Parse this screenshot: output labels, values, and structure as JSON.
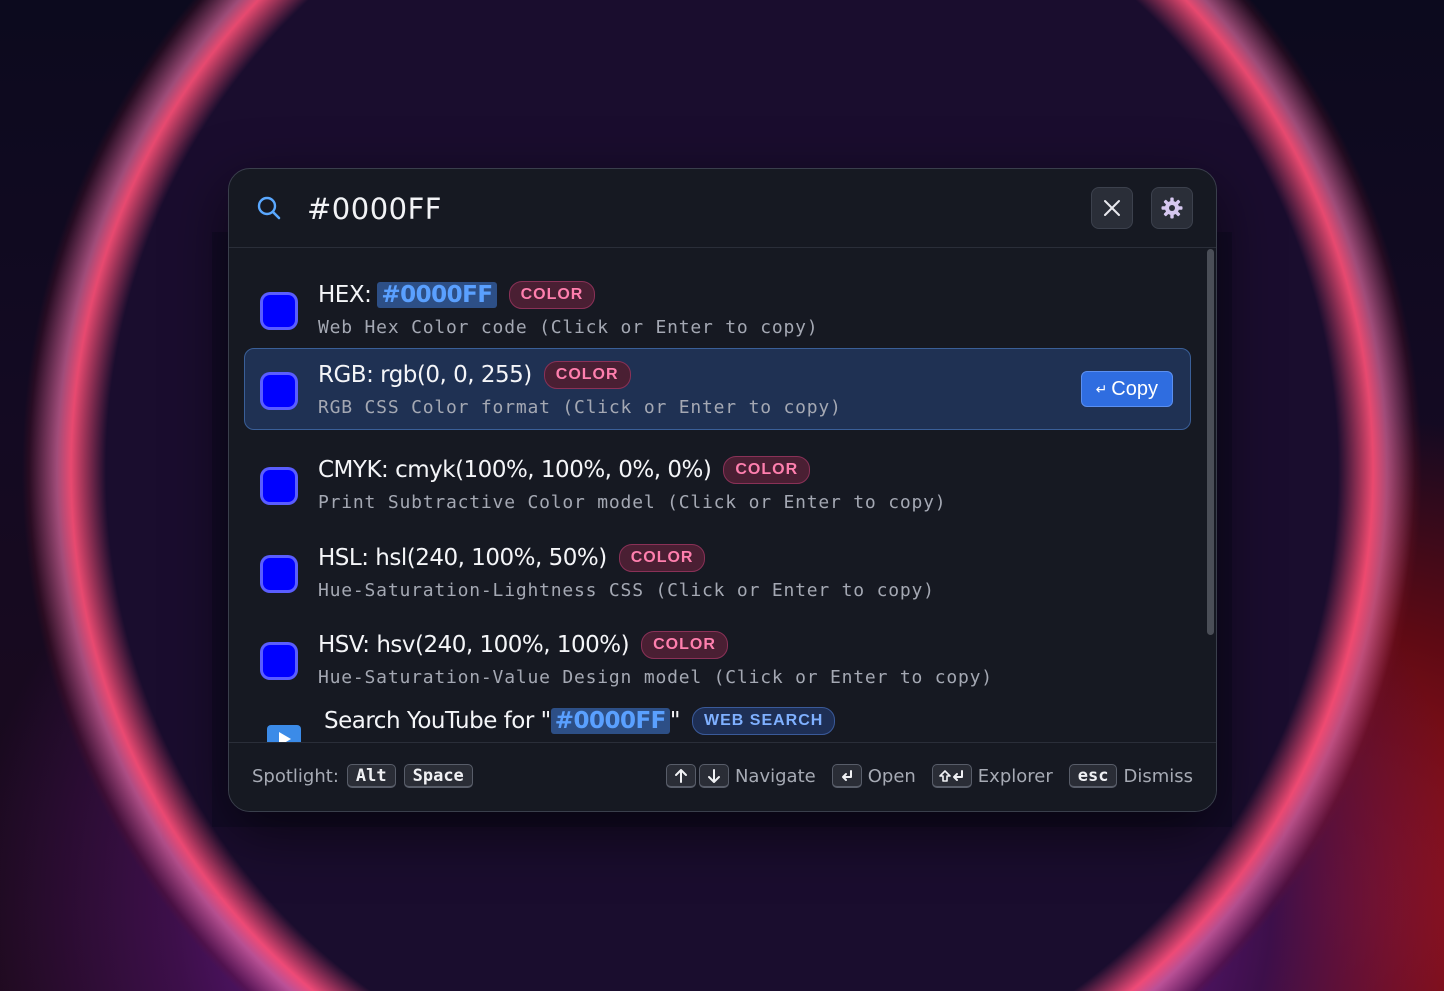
{
  "search": {
    "value": "#0000FF",
    "query": "#0000FF"
  },
  "results": [
    {
      "prefix": "HEX:",
      "highlight": "#0000FF",
      "badge": "COLOR",
      "subtitle": "Web Hex Color code (Click or Enter to copy)",
      "swatch": "#0000FF"
    },
    {
      "prefix": "RGB: rgb(0, 0, 255)",
      "badge": "COLOR",
      "subtitle": "RGB CSS Color format (Click or Enter to copy)",
      "swatch": "#0000FF",
      "selected": true
    },
    {
      "prefix": "CMYK: cmyk(100%, 100%, 0%, 0%)",
      "badge": "COLOR",
      "subtitle": "Print Subtractive Color model (Click or Enter to copy)",
      "swatch": "#0000FF"
    },
    {
      "prefix": "HSL: hsl(240, 100%, 50%)",
      "badge": "COLOR",
      "subtitle": "Hue-Saturation-Lightness CSS (Click or Enter to copy)",
      "swatch": "#0000FF"
    },
    {
      "prefix": "HSV: hsv(240, 100%, 100%)",
      "badge": "COLOR",
      "subtitle": "Hue-Saturation-Value Design model (Click or Enter to copy)",
      "swatch": "#0000FF"
    }
  ],
  "youtube": {
    "prefix": "Search YouTube for \"",
    "highlight": "#0000FF",
    "suffix": "\"",
    "badge": "WEB SEARCH"
  },
  "copy_button": {
    "icon": "↵",
    "label": "Copy"
  },
  "footer": {
    "spotlight_label": "Spotlight:",
    "spotlight_keys": [
      "Alt",
      "Space"
    ],
    "navigate_label": "Navigate",
    "open_label": "Open",
    "explorer_label": "Explorer",
    "dismiss_key": "esc",
    "dismiss_label": "Dismiss"
  },
  "colors": {
    "swatch": "#0000FF",
    "accent": "#2f6de0",
    "highlight_text": "#5aa0ff",
    "badge_color_text": "#ff7fae",
    "badge_web_text": "#7fb0ff"
  },
  "icons": {
    "search": "search-icon",
    "close": "close-icon",
    "settings": "gear-icon",
    "youtube": "youtube-icon",
    "enter": "enter-icon",
    "arrow_up": "arrow-up-icon",
    "arrow_down": "arrow-down-icon",
    "shift_enter": "shift-enter-icon"
  }
}
